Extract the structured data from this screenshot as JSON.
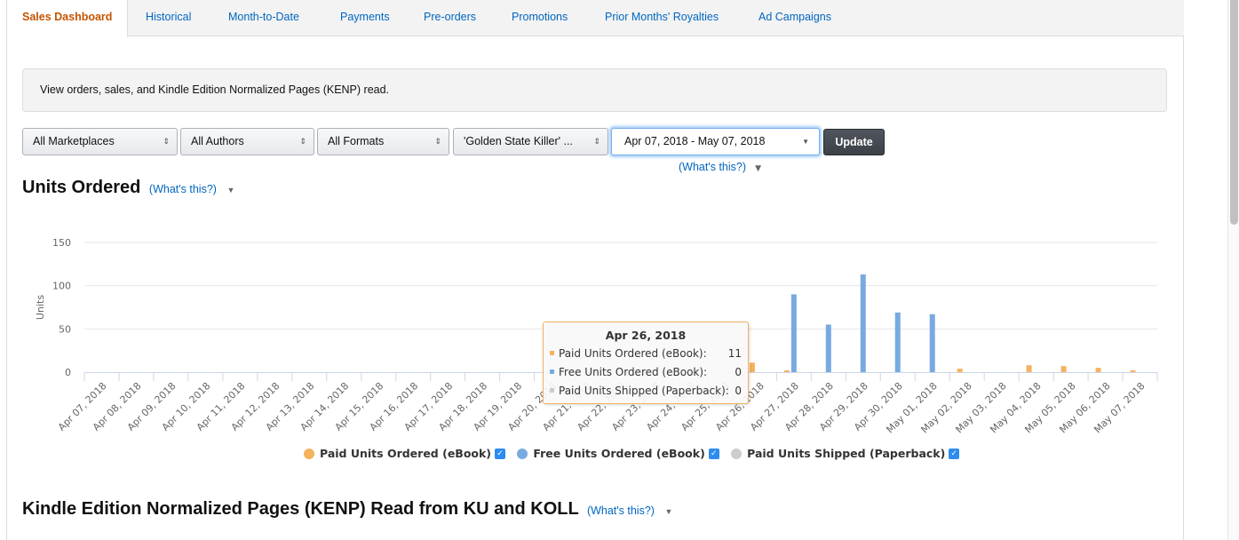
{
  "tabs": [
    {
      "label": "Sales Dashboard",
      "active": true
    },
    {
      "label": "Historical"
    },
    {
      "label": "Month-to-Date"
    },
    {
      "label": "Payments"
    },
    {
      "label": "Pre-orders"
    },
    {
      "label": "Promotions"
    },
    {
      "label": "Prior Months' Royalties"
    },
    {
      "label": "Ad Campaigns"
    }
  ],
  "info_text": "View orders, sales, and Kindle Edition Normalized Pages (KENP) read.",
  "filters": {
    "marketplace": "All Marketplaces",
    "authors": "All Authors",
    "formats": "All Formats",
    "title": "'Golden State Killer' ...",
    "date_range": "Apr 07, 2018 - May 07, 2018",
    "update_label": "Update",
    "whats_this": "(What's this?)"
  },
  "sections": {
    "units_ordered": {
      "title": "Units Ordered",
      "whats_this": "(What's this?)"
    },
    "kenp": {
      "title": "Kindle Edition Normalized Pages (KENP) Read from KU and KOLL",
      "whats_this": "(What's this?)"
    }
  },
  "colors": {
    "paid": "#f5b25f",
    "free": "#77abe0",
    "paperback": "#cccccc",
    "link": "#0066c0",
    "active_tab": "#c45500"
  },
  "tooltip": {
    "date": "Apr 26, 2018",
    "rows": [
      {
        "label": "Paid Units Ordered (eBook):",
        "value": "11"
      },
      {
        "label": "Free Units Ordered (eBook):",
        "value": "0"
      },
      {
        "label": "Paid Units Shipped (Paperback):",
        "value": "0"
      }
    ]
  },
  "chart_data": {
    "type": "bar",
    "title": "Units Ordered",
    "xlabel": "",
    "ylabel": "Units",
    "ylim": [
      0,
      150
    ],
    "yticks": [
      0,
      50,
      100,
      150
    ],
    "grid": true,
    "legend_position": "bottom",
    "categories": [
      "Apr 07, 2018",
      "Apr 08, 2018",
      "Apr 09, 2018",
      "Apr 10, 2018",
      "Apr 11, 2018",
      "Apr 12, 2018",
      "Apr 13, 2018",
      "Apr 14, 2018",
      "Apr 15, 2018",
      "Apr 16, 2018",
      "Apr 17, 2018",
      "Apr 18, 2018",
      "Apr 19, 2018",
      "Apr 20, 2018",
      "Apr 21, 2018",
      "Apr 22, 2018",
      "Apr 23, 2018",
      "Apr 24, 2018",
      "Apr 25, 2018",
      "Apr 26, 2018",
      "Apr 27, 2018",
      "Apr 28, 2018",
      "Apr 29, 2018",
      "Apr 30, 2018",
      "May 01, 2018",
      "May 02, 2018",
      "May 03, 2018",
      "May 04, 2018",
      "May 05, 2018",
      "May 06, 2018",
      "May 07, 2018"
    ],
    "series": [
      {
        "name": "Paid Units Ordered (eBook)",
        "color": "#f5b25f",
        "checked": true,
        "values": [
          0,
          0,
          0,
          0,
          0,
          0,
          0,
          0,
          0,
          0,
          0,
          0,
          0,
          0,
          0,
          0,
          0,
          0,
          0,
          11,
          2,
          0,
          0,
          0,
          0,
          4,
          0,
          8,
          7,
          5,
          2
        ]
      },
      {
        "name": "Free Units Ordered (eBook)",
        "color": "#77abe0",
        "checked": true,
        "values": [
          0,
          0,
          0,
          0,
          0,
          0,
          0,
          0,
          0,
          0,
          0,
          0,
          0,
          0,
          0,
          0,
          0,
          0,
          0,
          0,
          90,
          55,
          113,
          69,
          67,
          0,
          0,
          0,
          0,
          0,
          0
        ]
      },
      {
        "name": "Paid Units Shipped (Paperback)",
        "color": "#cccccc",
        "checked": true,
        "values": [
          0,
          0,
          0,
          0,
          0,
          0,
          0,
          0,
          0,
          0,
          0,
          0,
          0,
          0,
          0,
          0,
          0,
          0,
          0,
          0,
          0,
          0,
          0,
          0,
          0,
          0,
          0,
          0,
          0,
          0,
          0
        ]
      }
    ]
  }
}
